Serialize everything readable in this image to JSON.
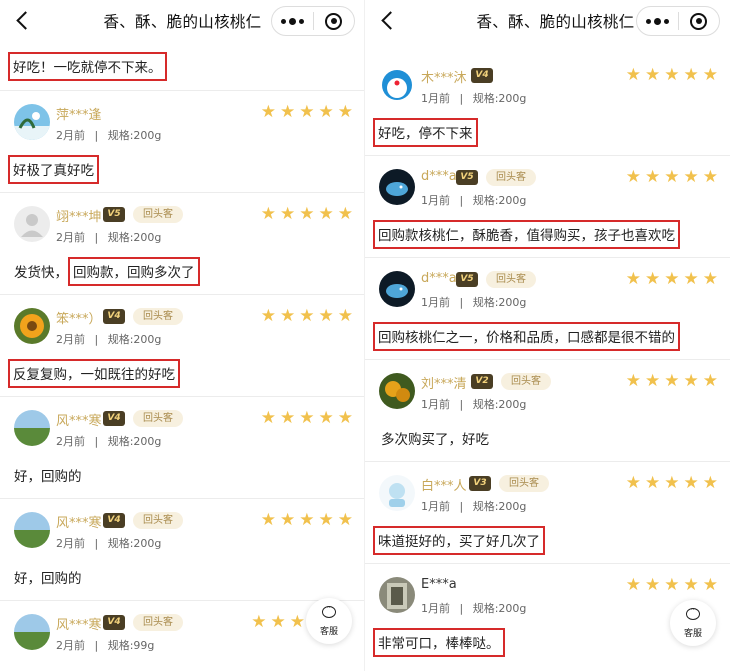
{
  "left": {
    "title": "香、酥、脆的山核桃仁",
    "top_text": "好吃！一吃就停不下来。",
    "reviews": [
      {
        "name": "萍***逢",
        "badge": "",
        "tag": "",
        "date": "2月前",
        "spec": "规格:200g",
        "comment_plain": "",
        "comment_hl": "好极了真好吃"
      },
      {
        "name": "翊***坤",
        "badge": "V5",
        "tag": "回头客",
        "date": "2月前",
        "spec": "规格:200g",
        "comment_plain": "发货快，",
        "comment_hl": "回购款，回购多次了"
      },
      {
        "name": "笨***）",
        "badge": "V4",
        "tag": "回头客",
        "date": "2月前",
        "spec": "规格:200g",
        "comment_plain": "",
        "comment_hl": "反复复购，一如既往的好吃"
      },
      {
        "name": "风***寒",
        "badge": "V4",
        "tag": "回头客",
        "date": "2月前",
        "spec": "规格:200g",
        "comment_plain": "好，回购的",
        "comment_hl": ""
      },
      {
        "name": "风***寒",
        "badge": "V4",
        "tag": "回头客",
        "date": "2月前",
        "spec": "规格:200g",
        "comment_plain": "好，回购的",
        "comment_hl": ""
      },
      {
        "name": "风***寒",
        "badge": "V4",
        "tag": "回头客",
        "date": "2月前",
        "spec": "规格:99g",
        "comment_plain": "",
        "comment_hl": ""
      }
    ],
    "fab_label": "客服"
  },
  "right": {
    "title": "香、酥、脆的山核桃仁",
    "reviews": [
      {
        "name": "木***沐",
        "badge": "V4",
        "tag": "",
        "date": "1月前",
        "spec": "规格:200g",
        "comment_plain": "",
        "comment_hl": "好吃，停不下来"
      },
      {
        "name": "d***a",
        "badge": "V5",
        "tag": "回头客",
        "date": "1月前",
        "spec": "规格:200g",
        "comment_plain": "",
        "comment_hl": "回购款核桃仁，酥脆香，值得购买，孩子也喜欢吃"
      },
      {
        "name": "d***a",
        "badge": "V5",
        "tag": "回头客",
        "date": "1月前",
        "spec": "规格:200g",
        "comment_plain": "",
        "comment_hl": "回购核桃仁之一，价格和品质，口感都是很不错的"
      },
      {
        "name": "刘***清",
        "badge": "V2",
        "tag": "回头客",
        "date": "1月前",
        "spec": "规格:200g",
        "comment_plain": "多次购买了，好吃",
        "comment_hl": ""
      },
      {
        "name": "白***人",
        "badge": "V3",
        "tag": "回头客",
        "date": "1月前",
        "spec": "规格:200g",
        "comment_plain": "",
        "comment_hl": "味道挺好的，买了好几次了"
      },
      {
        "name": "E***a",
        "badge": "",
        "tag": "",
        "date": "1月前",
        "spec": "规格:200g",
        "comment_plain": "",
        "comment_hl": "非常可口，棒棒哒。"
      }
    ],
    "fab_label": "客服"
  },
  "meta_separator": "|",
  "star_glyph": "★",
  "colors": {
    "highlight": "#d62a2a",
    "star": "#f1c14d",
    "username": "#c8a85a",
    "tag_bg": "#f7f0df"
  }
}
